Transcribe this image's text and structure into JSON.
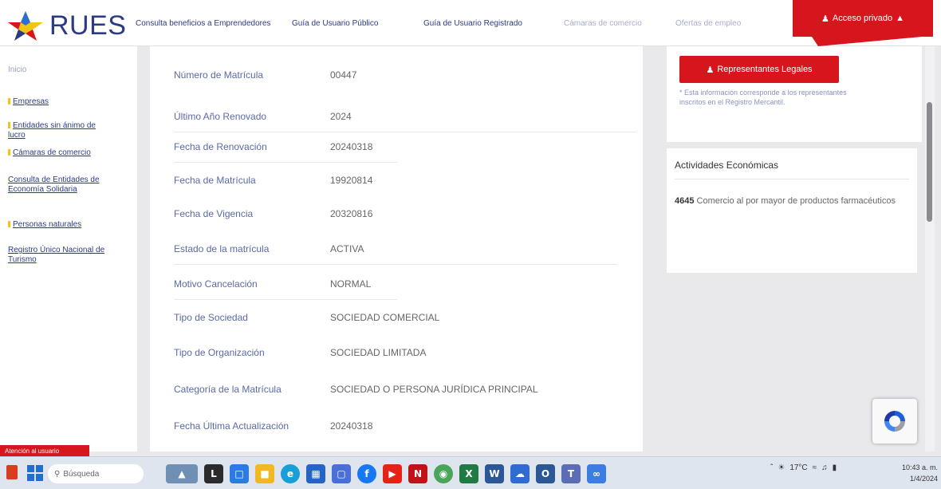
{
  "header": {
    "logo_text": "RUES",
    "nav": [
      {
        "label": "Consulta beneficios a Emprendedores",
        "muted": false
      },
      {
        "label": "Guía de Usuario Público",
        "muted": false
      },
      {
        "label": "Guía de Usuario Registrado",
        "muted": false
      },
      {
        "label": "Cámaras de comercio",
        "muted": true
      },
      {
        "label": "Ofertas de empleo",
        "muted": true
      }
    ],
    "user_button": "Acceso privado"
  },
  "sidebar": {
    "items": [
      {
        "label": "Inicio",
        "top": 0
      },
      {
        "label": "Empresas",
        "top": 0
      },
      {
        "label": "Entidades sin ánimo de lucro",
        "top": 0
      },
      {
        "label": "Cámaras de comercio",
        "top": 0
      },
      {
        "label": "Consulta de Entidades de Economía Solidaria",
        "top": 0
      },
      {
        "label": "Personas naturales",
        "top": 0
      },
      {
        "label": "Registro Único Nacional de Turismo",
        "top": 0
      }
    ]
  },
  "details": {
    "rows": [
      {
        "label": "Número de Matrícula",
        "value": "00447"
      },
      {
        "label": "Último Año Renovado",
        "value": "2024"
      },
      {
        "label": "Fecha de Renovación",
        "value": "20240318"
      },
      {
        "label": "Fecha de Matrícula",
        "value": "19920814"
      },
      {
        "label": "Fecha de Vigencia",
        "value": "20320816"
      },
      {
        "label": "Estado de la matrícula",
        "value": "ACTIVA"
      },
      {
        "label": "Motivo Cancelación",
        "value": "NORMAL"
      },
      {
        "label": "Tipo de Sociedad",
        "value": "SOCIEDAD COMERCIAL"
      },
      {
        "label": "Tipo de Organización",
        "value": "SOCIEDAD LIMITADA"
      },
      {
        "label": "Categoría de la Matrícula",
        "value": "SOCIEDAD O PERSONA JURÍDICA PRINCIPAL"
      },
      {
        "label": "Fecha Última Actualización",
        "value": "20240318"
      }
    ]
  },
  "right_panel": {
    "rep_button": "Representantes Legales",
    "rep_note": "* Esta información corresponde a los representantes inscritos en el Registro Mercantil.",
    "activities_title": "Actividades Económicas",
    "activity_code": "4645",
    "activity_desc": "Comercio al por mayor de productos farmacéuticos"
  },
  "bottom_tab": "Atención al usuario",
  "taskbar": {
    "search_placeholder": "Búsqueda",
    "temperature": "17°C",
    "clock_time": "10:43 a. m.",
    "clock_date": "1/4/2024"
  },
  "colors": {
    "brand_red": "#d6161c",
    "brand_blue": "#2c3a86"
  }
}
